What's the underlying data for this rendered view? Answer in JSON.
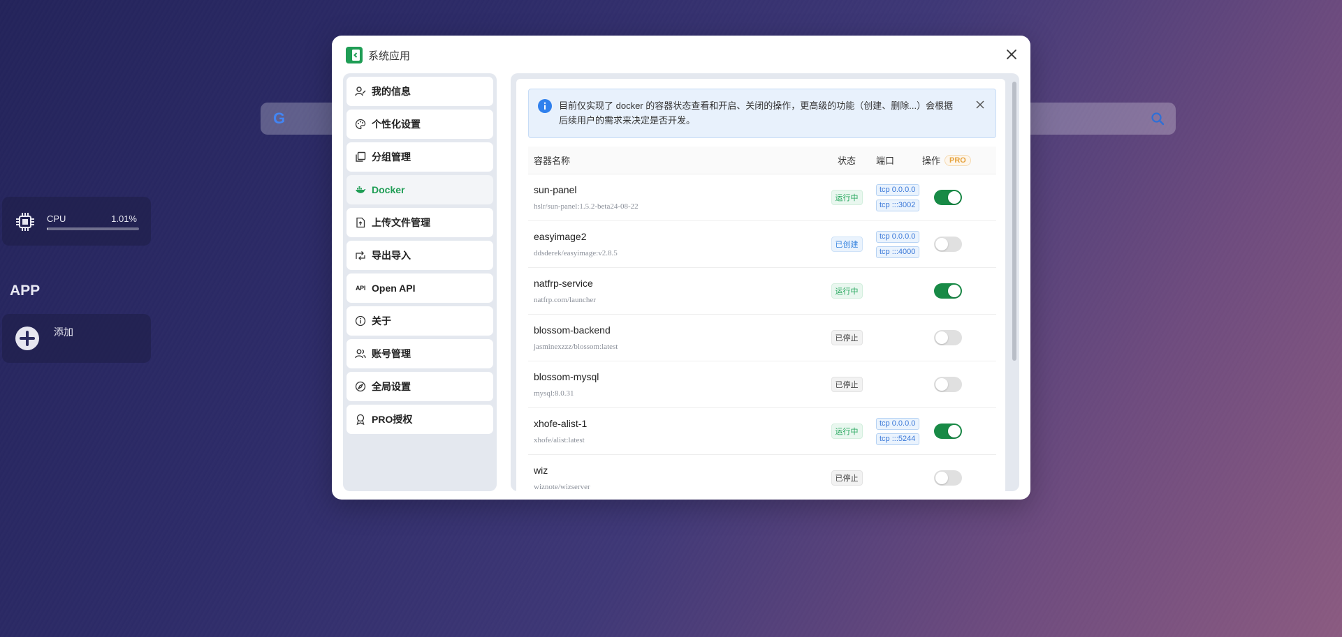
{
  "background": {
    "search": {
      "google_glyph": "G"
    },
    "cpu": {
      "label": "CPU",
      "value": "1.01%",
      "usage_fraction": 0.0101
    },
    "app_heading": "APP",
    "add_label": "添加"
  },
  "modal": {
    "title": "系统应用",
    "menu": [
      {
        "id": "my-info",
        "label": "我的信息",
        "icon": "user-edit-icon"
      },
      {
        "id": "personalize",
        "label": "个性化设置",
        "icon": "palette-icon"
      },
      {
        "id": "groups",
        "label": "分组管理",
        "icon": "copy-icon"
      },
      {
        "id": "docker",
        "label": "Docker",
        "icon": "docker-icon",
        "active": true
      },
      {
        "id": "uploads",
        "label": "上传文件管理",
        "icon": "file-upload-icon"
      },
      {
        "id": "export-import",
        "label": "导出导入",
        "icon": "transfer-icon"
      },
      {
        "id": "open-api",
        "label": "Open API",
        "icon": "api-icon",
        "icon_text": "API"
      },
      {
        "id": "about",
        "label": "关于",
        "icon": "info-icon"
      },
      {
        "id": "accounts",
        "label": "账号管理",
        "icon": "users-icon"
      },
      {
        "id": "global",
        "label": "全局设置",
        "icon": "compass-icon"
      },
      {
        "id": "pro",
        "label": "PRO授权",
        "icon": "award-icon"
      }
    ],
    "notice": "目前仅实现了 docker 的容器状态查看和开启、关闭的操作，更高级的功能（创建、删除...）会根据后续用户的需求来决定是否开发。",
    "table": {
      "headers": {
        "name": "容器名称",
        "status": "状态",
        "ports": "端口",
        "action": "操作",
        "pro": "PRO"
      },
      "rows": [
        {
          "name": "sun-panel",
          "image": "hslr/sun-panel:1.5.2-beta24-08-22",
          "status": "运行中",
          "status_kind": "running",
          "ports": [
            "tcp 0.0.0.0",
            "tcp :::3002"
          ],
          "enabled": true
        },
        {
          "name": "easyimage2",
          "image": "ddsderek/easyimage:v2.8.5",
          "status": "已创建",
          "status_kind": "created",
          "ports": [
            "tcp 0.0.0.0",
            "tcp :::4000"
          ],
          "enabled": false
        },
        {
          "name": "natfrp-service",
          "image": "natfrp.com/launcher",
          "status": "运行中",
          "status_kind": "running",
          "ports": [],
          "enabled": true
        },
        {
          "name": "blossom-backend",
          "image": "jasminexzzz/blossom:latest",
          "status": "已停止",
          "status_kind": "stopped",
          "ports": [],
          "enabled": false
        },
        {
          "name": "blossom-mysql",
          "image": "mysql:8.0.31",
          "status": "已停止",
          "status_kind": "stopped",
          "ports": [],
          "enabled": false
        },
        {
          "name": "xhofe-alist-1",
          "image": "xhofe/alist:latest",
          "status": "运行中",
          "status_kind": "running",
          "ports": [
            "tcp 0.0.0.0",
            "tcp :::5244"
          ],
          "enabled": true
        },
        {
          "name": "wiz",
          "image": "wiznote/wizserver",
          "status": "已停止",
          "status_kind": "stopped",
          "ports": [],
          "enabled": false
        }
      ]
    }
  }
}
